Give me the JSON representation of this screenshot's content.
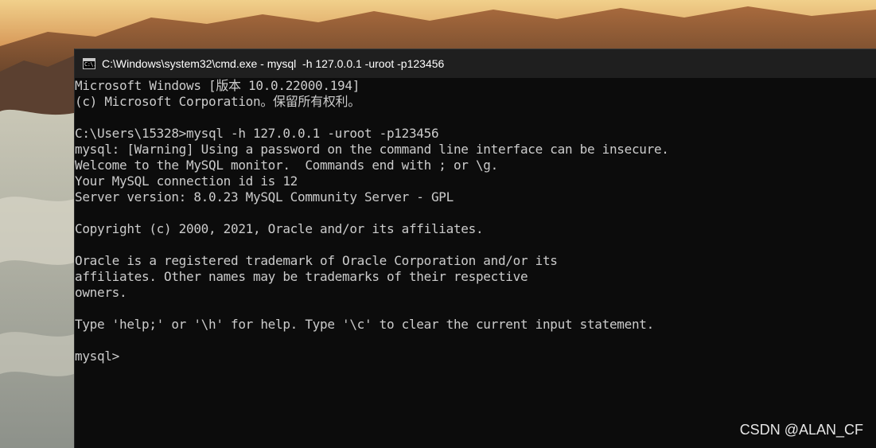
{
  "window": {
    "title": "C:\\Windows\\system32\\cmd.exe - mysql  -h 127.0.0.1 -uroot -p123456",
    "icon": "cmd-icon",
    "icon_glyph": "C:\\."
  },
  "console": {
    "lines": [
      "Microsoft Windows [版本 10.0.22000.194]",
      "(c) Microsoft Corporation。保留所有权利。",
      "",
      "C:\\Users\\15328>mysql -h 127.0.0.1 -uroot -p123456",
      "mysql: [Warning] Using a password on the command line interface can be insecure.",
      "Welcome to the MySQL monitor.  Commands end with ; or \\g.",
      "Your MySQL connection id is 12",
      "Server version: 8.0.23 MySQL Community Server - GPL",
      "",
      "Copyright (c) 2000, 2021, Oracle and/or its affiliates.",
      "",
      "Oracle is a registered trademark of Oracle Corporation and/or its",
      "affiliates. Other names may be trademarks of their respective",
      "owners.",
      "",
      "Type 'help;' or '\\h' for help. Type '\\c' to clear the current input statement.",
      "",
      "mysql>"
    ]
  },
  "watermark": "CSDN @ALAN_CF",
  "colors": {
    "console_bg": "#0c0c0c",
    "console_text": "#cccccc",
    "titlebar_bg": "#1f1f1f",
    "title_text": "#ffffff"
  }
}
